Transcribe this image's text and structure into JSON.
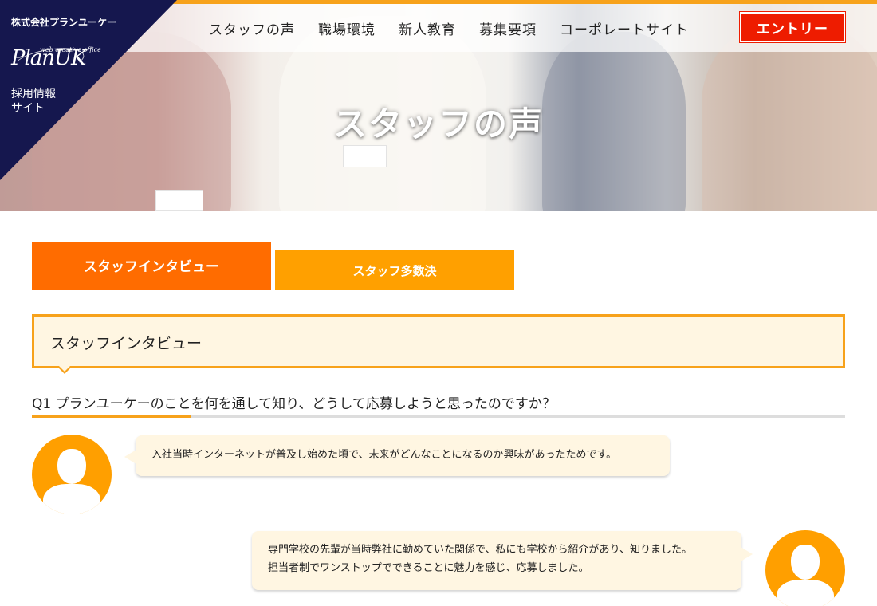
{
  "header": {
    "company_name": "株式会社プランユーケー",
    "logo_text": "PlanUK",
    "logo_subtext": "web creative office",
    "tagline_line1": "採用情報",
    "tagline_line2": "サイト",
    "nav": [
      "スタッフの声",
      "職場環境",
      "新人教育",
      "募集要項",
      "コーポレートサイト"
    ],
    "entry_label": "エントリー"
  },
  "hero": {
    "title": "スタッフの声"
  },
  "tabs": {
    "active_label": "スタッフインタビュー",
    "inactive_label": "スタッフ多数決"
  },
  "section": {
    "title": "スタッフインタビュー"
  },
  "qa": {
    "question": "Q1 プランユーケーのことを何を通して知り、どうして応募しようと思ったのですか？",
    "answer1": "入社当時インターネットが普及し始めた頃で、未来がどんなことになるのか興味があったためです。",
    "answer2_line1": "専門学校の先輩が当時弊社に勤めていた関係で、私にも学校から紹介があり、知りました。",
    "answer2_line2": "担当者制でワンストップでできることに魅力を感じ、応募しました。"
  },
  "colors": {
    "accent_orange": "#f7a21b",
    "tab_active": "#ff6c00",
    "tab_inactive": "#ffa000",
    "entry_red": "#ee1c00",
    "logo_navy": "#15174e",
    "bubble_bg": "#fff6e2"
  }
}
